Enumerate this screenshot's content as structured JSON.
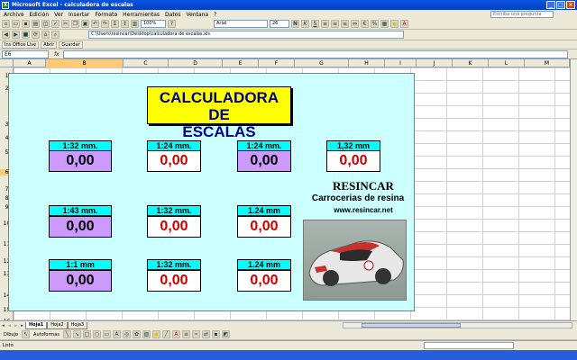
{
  "window": {
    "title": "Microsoft Excel - calculadora de escalas"
  },
  "menu": {
    "items": [
      "Archivo",
      "Edición",
      "Ver",
      "Insertar",
      "Formato",
      "Herramientas",
      "Datos",
      "Ventana",
      "?"
    ],
    "help_placeholder": "Escriba una pregunta"
  },
  "toolbar": {
    "font_name": "Arial",
    "font_size": "26",
    "zoom": "100%"
  },
  "toolbar3": {
    "tab_a": "Ins Office Live",
    "tab_b": "Abrir",
    "tab_c": "Guardar"
  },
  "formula": {
    "name_box": "E6",
    "fx_label": "fx",
    "path": "C:\\Users\\resincar\\Desktop\\calculadora de escalas.xls"
  },
  "columns": [
    "A",
    "B",
    "C",
    "D",
    "E",
    "F",
    "G",
    "H",
    "I",
    "J",
    "K",
    "L",
    "M"
  ],
  "rows": [
    "1",
    "2",
    "3",
    "4",
    "5",
    "6",
    "7",
    "8",
    "9",
    "10",
    "11",
    "12",
    "13",
    "14",
    "15",
    "16"
  ],
  "calculator": {
    "title_line1": "CALCULADORA DE",
    "title_line2": "ESCALAS",
    "cells": [
      {
        "label": "1:32 mm.",
        "value": "0,00",
        "style": "purple"
      },
      {
        "label": "1:24 mm.",
        "value": "0,00",
        "style": "white"
      },
      {
        "label": "1:24 mm.",
        "value": "0,00",
        "style": "purple"
      },
      {
        "label": "1,32 mm",
        "value": "0,00",
        "style": "white"
      },
      {
        "label": "1:43 mm.",
        "value": "0,00",
        "style": "purple"
      },
      {
        "label": "1:32 mm.",
        "value": "0,00",
        "style": "white"
      },
      {
        "label": "1.24 mm",
        "value": "0,00",
        "style": "white"
      },
      {
        "label": "1:1 mm",
        "value": "0,00",
        "style": "purple"
      },
      {
        "label": "1:32 mm.",
        "value": "0,00",
        "style": "white"
      },
      {
        "label": "1.24 mm",
        "value": "0,00",
        "style": "white"
      }
    ]
  },
  "brand": {
    "name": "RESINCAR",
    "tagline": "Carrocerias de resina",
    "url": "www.resincar.net"
  },
  "sheets": {
    "tab1": "Hoja1",
    "tab2": "Hoja2",
    "tab3": "Hoja3"
  },
  "drawbar": {
    "dibujo": "Dibujo",
    "autoformas": "Autoformas"
  },
  "status": {
    "text": "Listo"
  },
  "colors": {
    "title_bg": "#ffff00",
    "label_bg": "#00ffff",
    "purple_cell": "#cc99ff",
    "calc_bg": "#ccffff",
    "value_red": "#cc0000"
  }
}
